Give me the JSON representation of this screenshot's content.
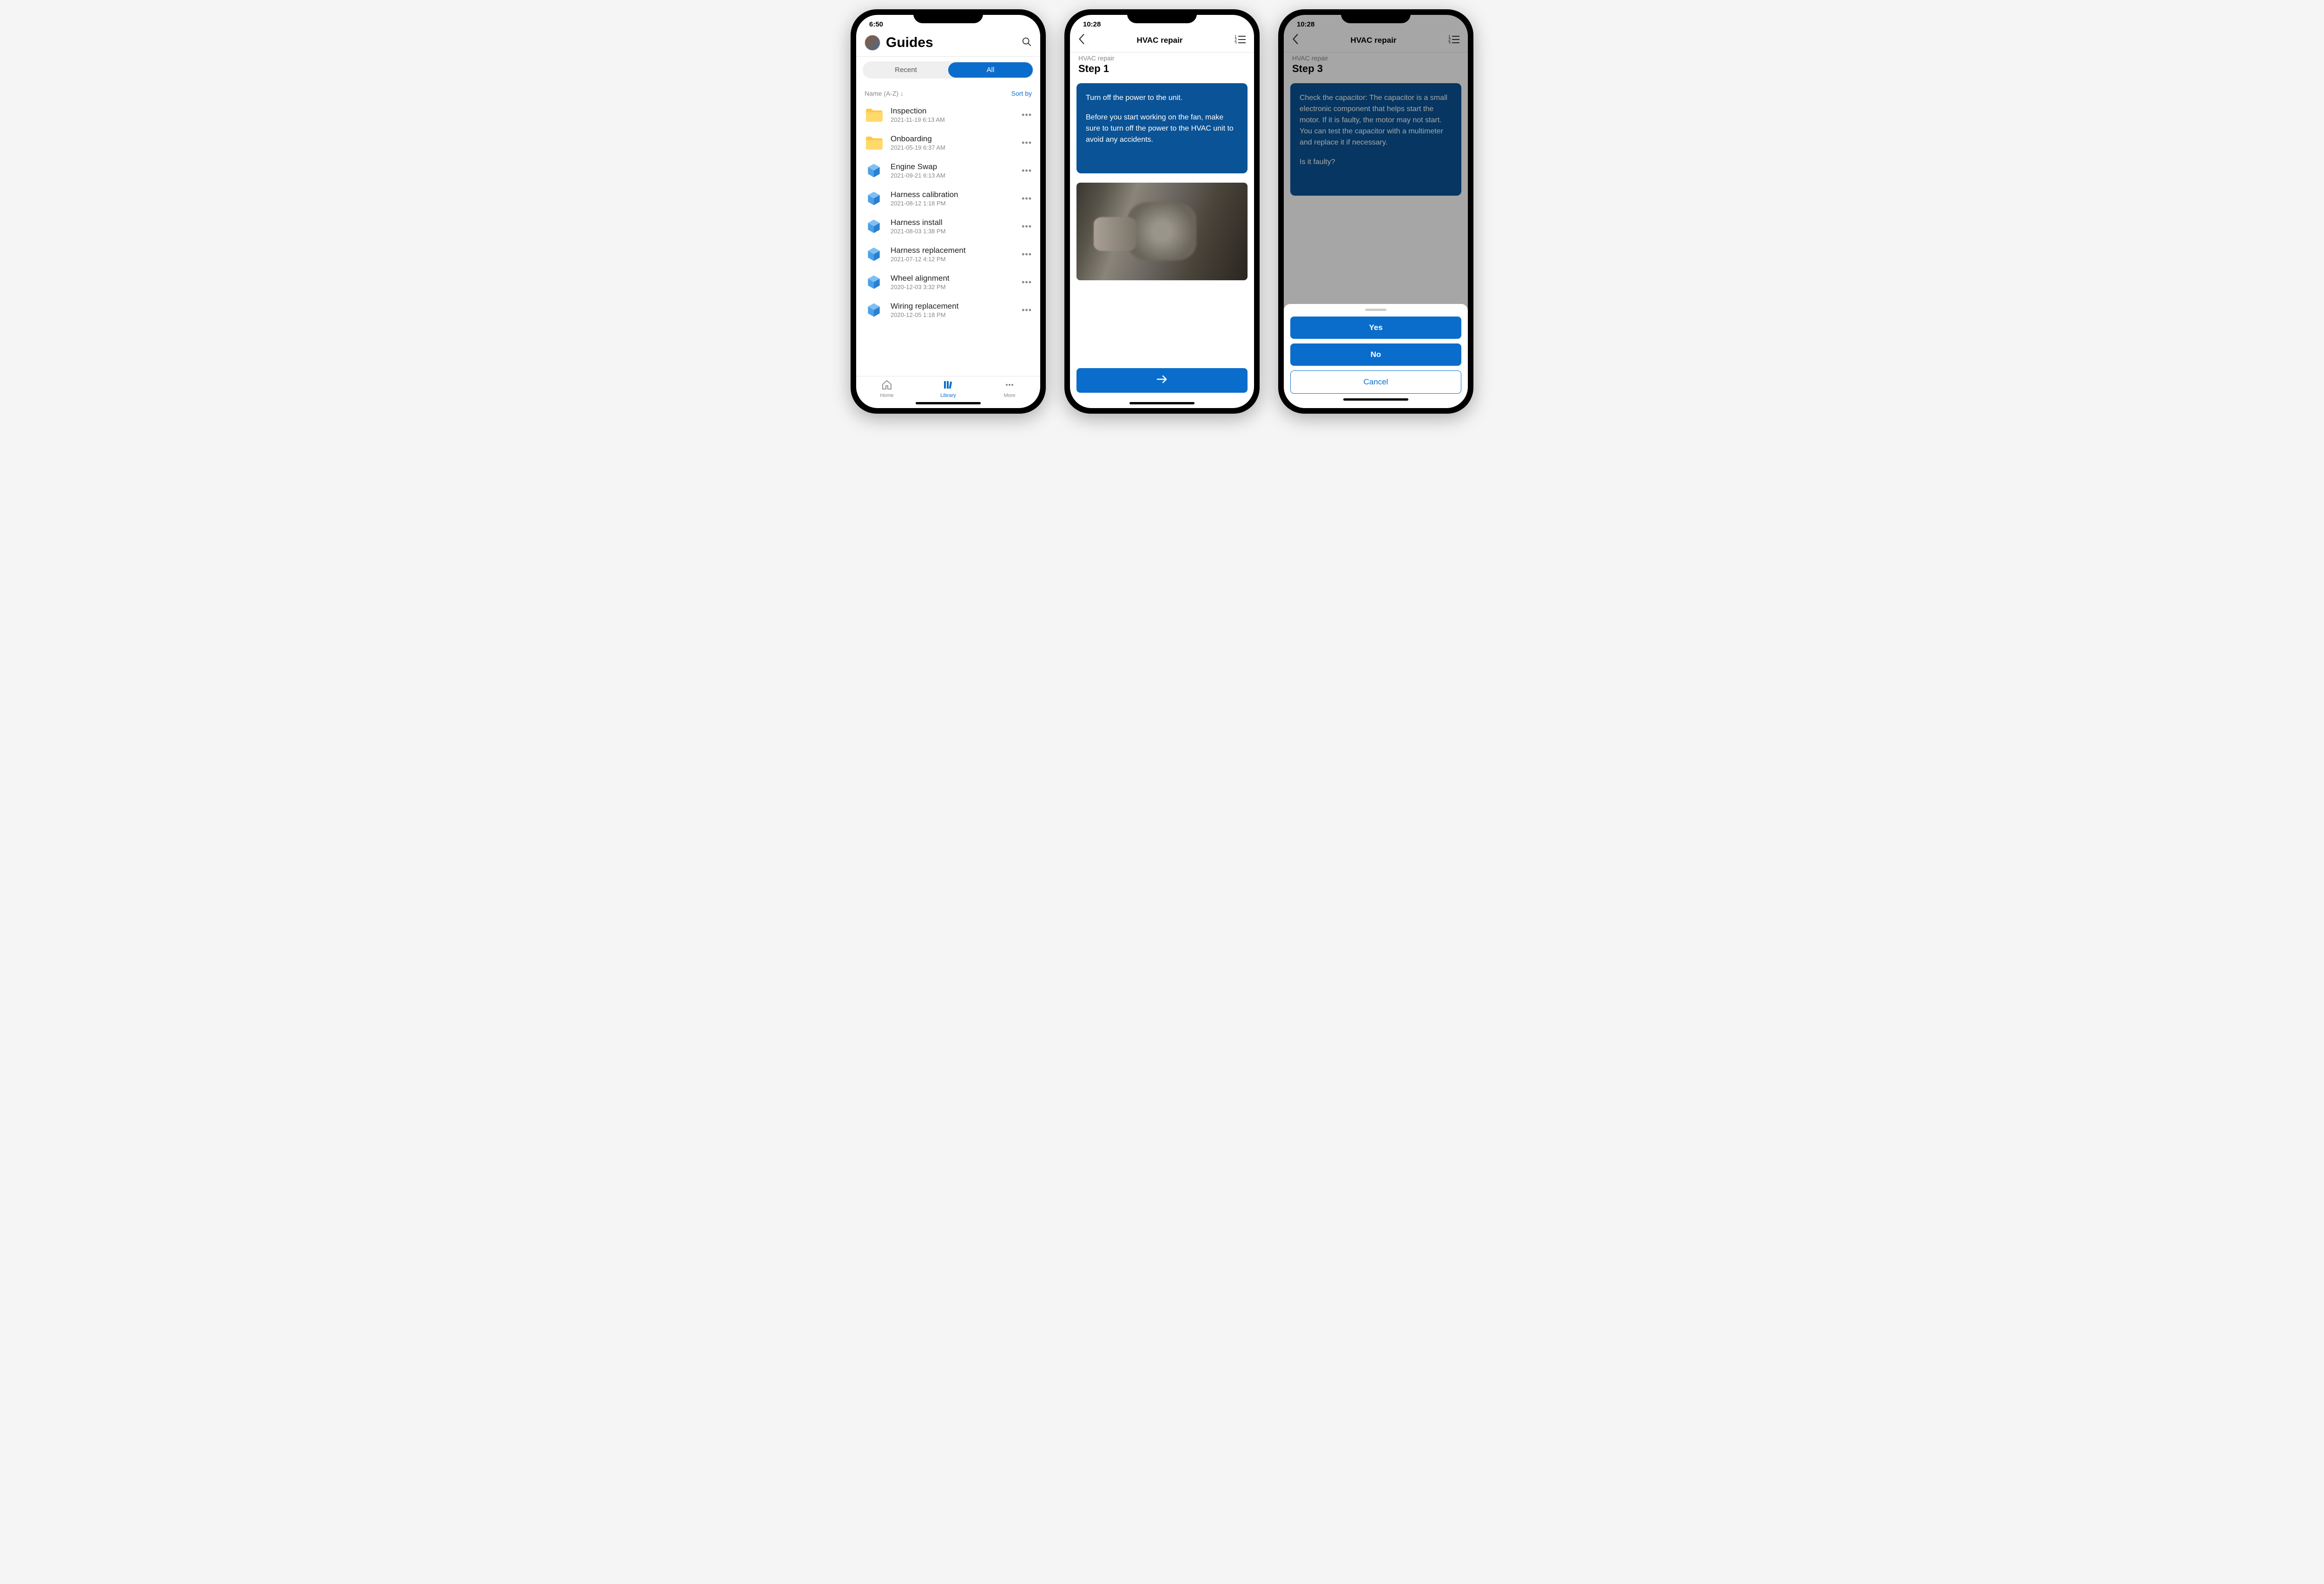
{
  "phone1": {
    "time": "6:50",
    "title": "Guides",
    "tabs": {
      "recent": "Recent",
      "all": "All"
    },
    "sort": {
      "label": "Name (A-Z)",
      "button": "Sort by"
    },
    "items": [
      {
        "type": "folder",
        "title": "Inspection",
        "date": "2021-11-19 6:13 AM"
      },
      {
        "type": "folder",
        "title": "Onboarding",
        "date": "2021-05-19 6:37 AM"
      },
      {
        "type": "guide",
        "title": "Engine Swap",
        "date": "2021-09-21 6:13 AM"
      },
      {
        "type": "guide",
        "title": "Harness calibration",
        "date": "2021-08-12 1:18 PM"
      },
      {
        "type": "guide",
        "title": "Harness install",
        "date": "2021-08-03 1:38 PM"
      },
      {
        "type": "guide",
        "title": "Harness replacement",
        "date": "2021-07-12 4:12 PM"
      },
      {
        "type": "guide",
        "title": "Wheel alignment",
        "date": "2020-12-03 3:32 PM"
      },
      {
        "type": "guide",
        "title": "Wiring replacement",
        "date": "2020-12-05 1:18 PM"
      }
    ],
    "nav": {
      "home": "Home",
      "library": "Library",
      "more": "More"
    }
  },
  "phone2": {
    "time": "10:28",
    "header": "HVAC repair",
    "breadcrumb": "HVAC repair",
    "step": "Step 1",
    "body_line1": "Turn off the power to the unit.",
    "body_line2": "Before you start working on the fan, make sure to turn off the power to the HVAC unit to avoid any accidents."
  },
  "phone3": {
    "time": "10:28",
    "header": "HVAC repair",
    "breadcrumb": "HVAC repair",
    "step": "Step 3",
    "body_line1": "Check the capacitor: The capacitor is a small electronic component that helps start the motor. If it is faulty, the motor may not start. You can test the capacitor with a multimeter and replace it if necessary.",
    "body_line2": "Is it faulty?",
    "actions": {
      "yes": "Yes",
      "no": "No",
      "cancel": "Cancel"
    }
  }
}
